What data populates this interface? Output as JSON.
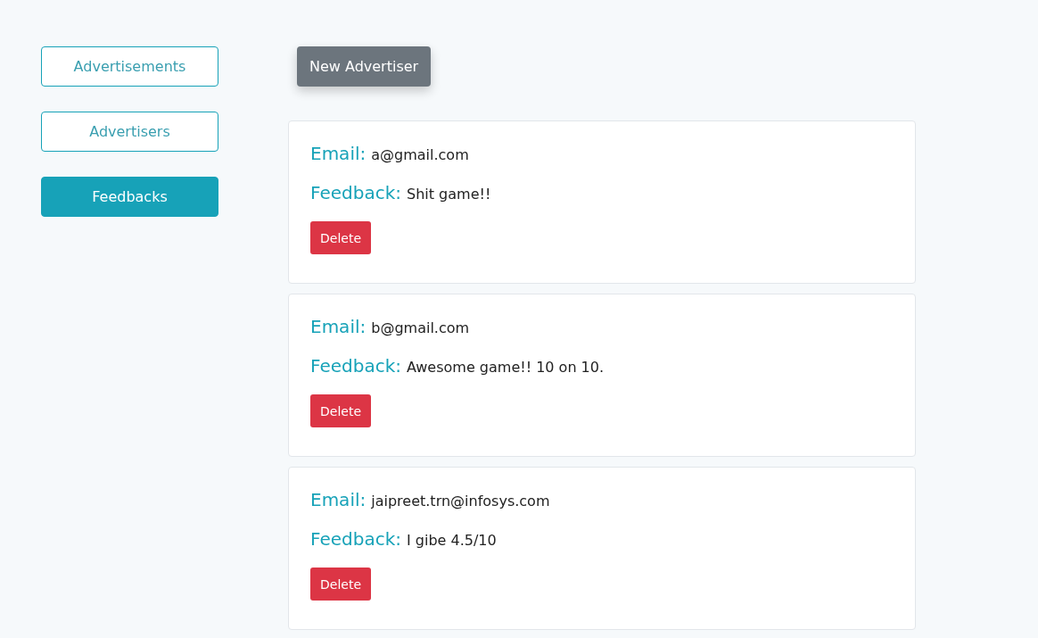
{
  "sidebar": {
    "items": [
      {
        "label": "Advertisements",
        "selected": false
      },
      {
        "label": "Advertisers",
        "selected": false
      },
      {
        "label": "Feedbacks",
        "selected": true
      }
    ]
  },
  "toolbar": {
    "new_button": "New Advertiser"
  },
  "feedbacks": [
    {
      "fields": [
        {
          "label": "Email:",
          "value": "a@gmail.com"
        },
        {
          "label": "Feedback:",
          "value": "Shit game!!"
        }
      ],
      "delete_button": "Delete"
    },
    {
      "fields": [
        {
          "label": "Email:",
          "value": "b@gmail.com"
        },
        {
          "label": "Feedback:",
          "value": "Awesome game!! 10 on 10."
        }
      ],
      "delete_button": "Delete"
    },
    {
      "fields": [
        {
          "label": "Email:",
          "value": "jaipreet.trn@infosys.com"
        },
        {
          "label": "Feedback:",
          "value": "I gibe 4.5/10"
        }
      ],
      "delete_button": "Delete"
    }
  ]
}
